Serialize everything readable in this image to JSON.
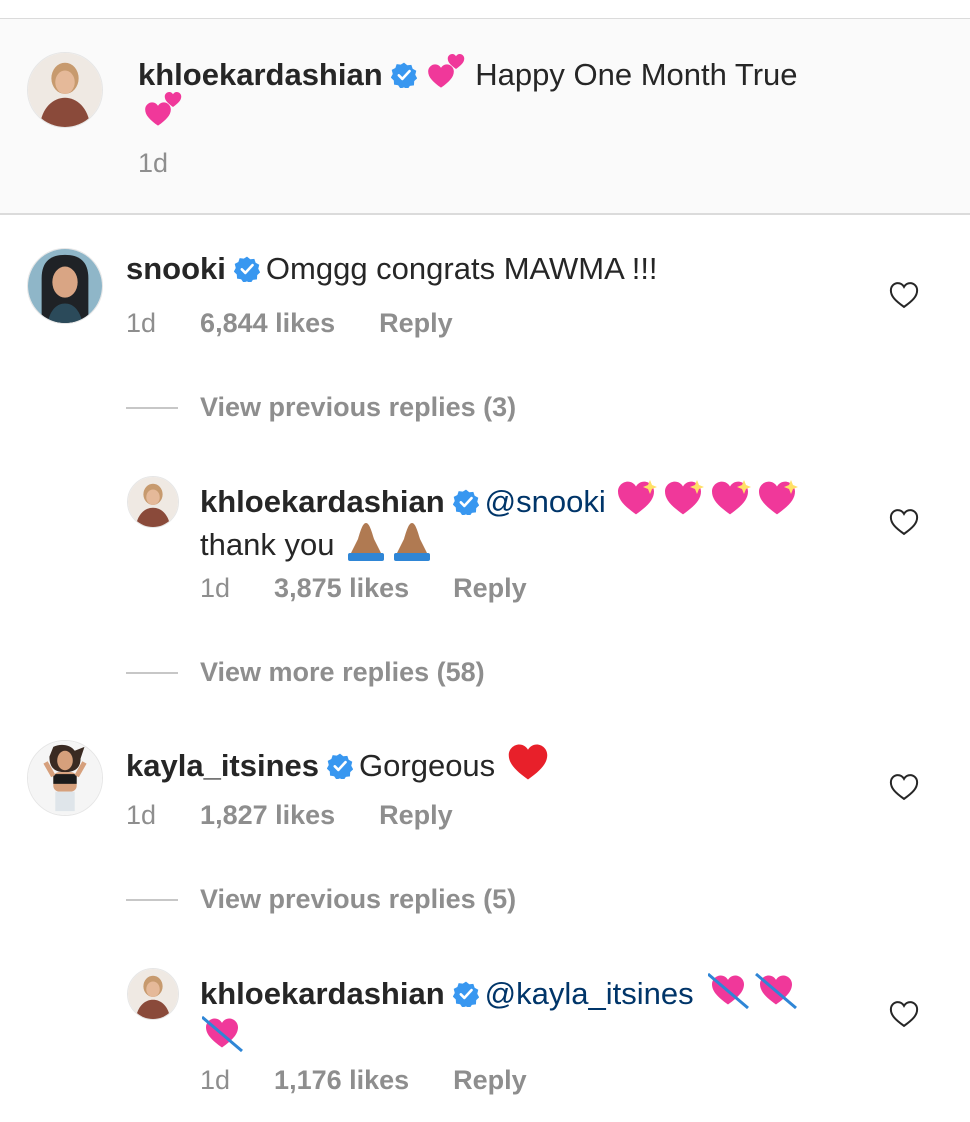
{
  "caption": {
    "username": "khloekardashian",
    "text": "Happy One Month True",
    "time": "1d"
  },
  "comments": [
    {
      "username": "snooki",
      "text": "Omggg congrats MAWMA !!!",
      "time": "1d",
      "likes": "6,844 likes",
      "reply": "Reply"
    },
    {
      "username": "kayla_itsines",
      "text": "Gorgeous",
      "time": "1d",
      "likes": "1,827 likes",
      "reply": "Reply"
    }
  ],
  "replies": [
    {
      "username": "khloekardashian",
      "mention": "@snooki",
      "text": "thank you",
      "time": "1d",
      "likes": "3,875 likes",
      "reply": "Reply"
    },
    {
      "username": "khloekardashian",
      "mention": "@kayla_itsines",
      "time": "1d",
      "likes": "1,176 likes",
      "reply": "Reply"
    }
  ],
  "view_links": {
    "prev_snooki": "View previous replies (3)",
    "more_snooki": "View more replies (58)",
    "prev_kayla": "View previous replies (5)"
  },
  "icons": {
    "verified": "verified-badge-icon",
    "like": "heart-outline-icon",
    "emoji_caption": "two-hearts-emoji",
    "emoji_sparkle": "sparkling-heart-emoji",
    "emoji_pray": "folded-hands-emoji",
    "emoji_red": "red-heart-emoji",
    "emoji_arrow": "heart-with-arrow-emoji"
  },
  "colors": {
    "verified": "#3897f0",
    "mention": "#003569",
    "meta": "#8e8e8e",
    "heart_pink": "#f0389a",
    "heart_red": "#e8202a"
  }
}
